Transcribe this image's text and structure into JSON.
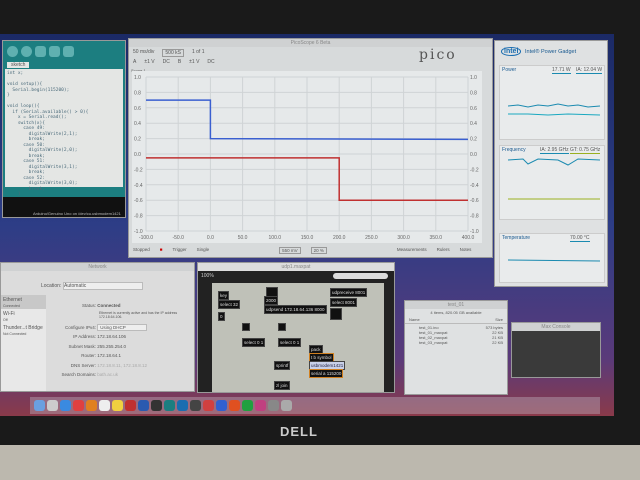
{
  "arduino": {
    "tab": "sketch",
    "code": "int x;\n\nvoid setup(){\n  Serial.begin(115200);\n}\n\nvoid loop(){\n  if (Serial.available() > 0){\n    x = Serial.read();\n    switch(x){\n      case 49:\n        digitalWrite(2,1);\n        break;\n      case 50:\n        digitalWrite(2,0);\n        break;\n      case 51:\n        digitalWrite(3,1);\n        break;\n      case 52:\n        digitalWrite(3,0);\n        break;\n    }\n  }\n}",
    "status": "Arduino/Genuino Uno on /dev/cu.usbmodem1421"
  },
  "pico": {
    "title": "PicoScope 6 Beta",
    "logo": "pico",
    "timebase": "50 ms/div",
    "samples": "500 kS",
    "capture": "1 of 1",
    "chA": "A",
    "chA_range": "±1 V",
    "chA_coupling": "DC",
    "chB": "B",
    "chB_range": "±1 V",
    "chB_coupling": "DC",
    "scope_tab": "Scope 1",
    "x_unit": "ms",
    "y_unit": "V",
    "status": "Stopped",
    "trigger_label": "Trigger",
    "trigger_mode": "Single",
    "trigger_level": "550 mV",
    "pretrigger": "20 %",
    "measurements": "Measurements",
    "rulers": "Rulers",
    "notes": "Notes"
  },
  "chart_data": {
    "type": "line",
    "xlim": [
      -100,
      400
    ],
    "ylim": [
      -1,
      1
    ],
    "x_ticks": [
      "-100.0",
      "-50.0",
      "0.0",
      "50.0",
      "100.0",
      "150.0",
      "200.0",
      "250.0",
      "300.0",
      "350.0",
      "400.0"
    ],
    "y_ticks": [
      "1.0",
      "0.8",
      "0.6",
      "0.4",
      "0.2",
      "0.0",
      "-0.2",
      "-0.4",
      "-0.6",
      "-0.8",
      "-1.0"
    ],
    "series": [
      {
        "name": "A",
        "color": "#3a5fd0",
        "points": [
          [
            -100,
            0.7
          ],
          [
            0,
            0.7
          ],
          [
            0,
            0.2
          ],
          [
            400,
            0.19
          ]
        ]
      },
      {
        "name": "B",
        "color": "#c03030",
        "points": [
          [
            -100,
            -0.05
          ],
          [
            200,
            -0.05
          ],
          [
            200,
            -0.6
          ],
          [
            400,
            -0.6
          ]
        ]
      }
    ]
  },
  "intel": {
    "title": "Intel® Power Gadget",
    "logo": "intel",
    "power_label": "Power",
    "power_pkg": "17.71 W",
    "power_ia": "IA: 12.04 W",
    "power_ticks": [
      "30",
      "25",
      "20",
      "15",
      "10",
      "5",
      "0"
    ],
    "freq_label": "Frequency",
    "freq_ia": "IA: 2.95 GHz",
    "freq_gt": "GT: 0.75 GHz",
    "freq_ticks": [
      "3.6",
      "2.4",
      "1.2",
      "0.0"
    ],
    "temp_label": "Temperature",
    "temp_val": "70.00 °C",
    "temp_ticks": [
      "100",
      "80",
      "60",
      "40"
    ]
  },
  "network": {
    "title": "Network",
    "location_label": "Location:",
    "location": "Automatic",
    "services": [
      {
        "name": "Ethernet",
        "sub": "Connected"
      },
      {
        "name": "Wi-Fi",
        "sub": "Off"
      },
      {
        "name": "Thunder...t Bridge",
        "sub": "Not Connected"
      }
    ],
    "status_label": "Status:",
    "status": "Connected",
    "status_desc": "Ethernet is currently active and has the IP address 172.18.64.106.",
    "ipv4_label": "Configure IPv4:",
    "ipv4": "Using DHCP",
    "ip_label": "IP Address:",
    "ip": "172.18.64.106",
    "mask_label": "Subnet Mask:",
    "mask": "255.255.254.0",
    "router_label": "Router:",
    "router": "172.18.64.1",
    "dns_label": "DNS Server:",
    "dns": "172.18.8.11, 172.18.8.12",
    "search_label": "Search Domains:",
    "search": "bath.ac.uk"
  },
  "max": {
    "title": "udp1.maxpat",
    "zoom": "100%",
    "objects": [
      "key",
      "select 32",
      "0",
      "udpsend 172.18.64.136 8000",
      "udpreceive 8001",
      "select 8001",
      "select 0 1",
      "select 0 1",
      "pack",
      "t b symbol",
      "sprintf",
      "zl join",
      "serial a 115200",
      "2000"
    ],
    "serial_port": "usbmodem1421"
  },
  "finder": {
    "title": "test_01",
    "info": "4 items, 820.05 GB available",
    "col_name": "Name",
    "col_size": "Size",
    "files": [
      {
        "name": "test_01.ino",
        "size": "573 bytes"
      },
      {
        "name": "test_01_maxpat",
        "size": "22 KB"
      },
      {
        "name": "test_02_maxpat",
        "size": "21 KB"
      },
      {
        "name": "test_03_maxpat",
        "size": "22 KB"
      }
    ]
  },
  "maxconsole": {
    "title": "Max Console"
  },
  "monitor": {
    "brand": "DELL"
  }
}
